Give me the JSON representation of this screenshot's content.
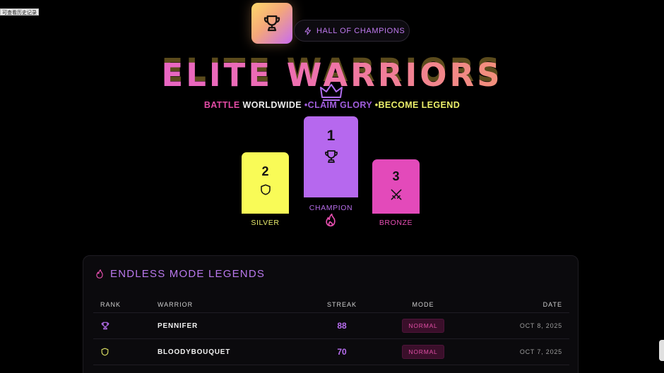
{
  "tooltip": "可查看历史记录",
  "header": {
    "logo_icon": "trophy-icon",
    "badge_icon": "lightning-icon",
    "badge_label": "HALL OF CHAMPIONS",
    "title": "ELITE WARRIORS",
    "crown_icon": "crown-icon"
  },
  "tagline": {
    "part1": "BATTLE ",
    "part2": "WORLDWIDE ",
    "part3": "•CLAIM GLORY ",
    "part4": "•BECOME LEGEND"
  },
  "podium": {
    "second": {
      "rank": "2",
      "label": "SILVER",
      "icon": "shield-icon",
      "color": "#f9fb57"
    },
    "first": {
      "rank": "1",
      "label": "CHAMPION",
      "icon": "trophy-icon",
      "color": "#b668ee",
      "extra_icon": "flame-icon"
    },
    "third": {
      "rank": "3",
      "label": "BRONZE",
      "icon": "crossed-swords-icon",
      "color": "#e34aba"
    }
  },
  "leaderboard": {
    "title": "ENDLESS MODE LEGENDS",
    "title_icon": "flame-icon",
    "columns": {
      "rank": "RANK",
      "warrior": "WARRIOR",
      "streak": "STREAK",
      "mode": "MODE",
      "date": "DATE"
    },
    "rows": [
      {
        "rank_icon": "trophy-icon",
        "warrior": "PENNIFER",
        "streak": "88",
        "mode": "NORMAL",
        "date": "OCT 8, 2025"
      },
      {
        "rank_icon": "shield-icon",
        "warrior": "BLOODYBOUQUET",
        "streak": "70",
        "mode": "NORMAL",
        "date": "OCT 7, 2025"
      }
    ]
  },
  "colors": {
    "accent_purple": "#b668ee",
    "accent_pink": "#e34aba",
    "accent_yellow": "#f9fb57"
  }
}
